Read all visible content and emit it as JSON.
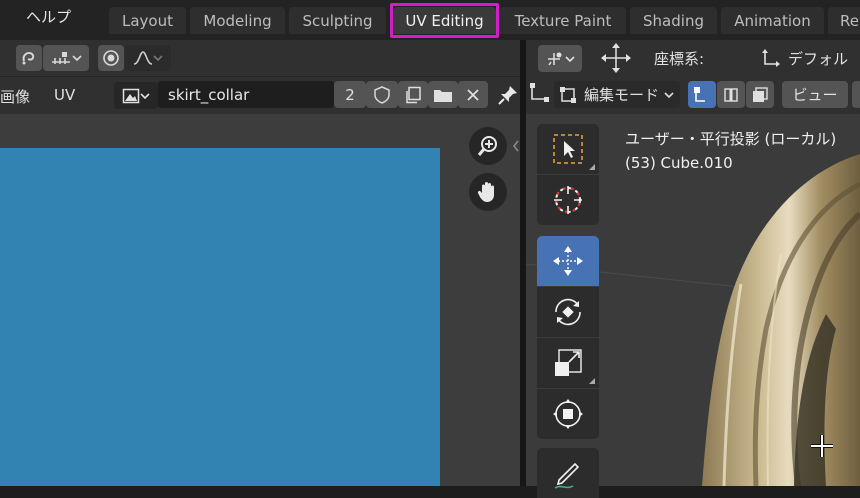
{
  "topbar": {
    "menu_help": "ヘルプ",
    "workspace_tabs": [
      {
        "label": "Layout",
        "active": false
      },
      {
        "label": "Modeling",
        "active": false
      },
      {
        "label": "Sculpting",
        "active": false
      },
      {
        "label": "UV Editing",
        "active": true
      },
      {
        "label": "Texture Paint",
        "active": false
      },
      {
        "label": "Shading",
        "active": false
      },
      {
        "label": "Animation",
        "active": false
      },
      {
        "label": "Re",
        "active": false
      }
    ],
    "highlight_color": "#d21ec8"
  },
  "uv_editor": {
    "menu_image": "画像",
    "menu_uv": "UV",
    "image_name": "skirt_collar",
    "user_count": "2",
    "image_color": "#3383b2"
  },
  "viewport_3d": {
    "coord_label": "座標系:",
    "coord_value": "デフォル",
    "mode_label": "編集モード",
    "view_menu": "ビュー",
    "view_name": "ユーザー・平行投影 (ローカル)",
    "object_name": "(53) Cube.010",
    "accent_color": "#4772b3"
  }
}
